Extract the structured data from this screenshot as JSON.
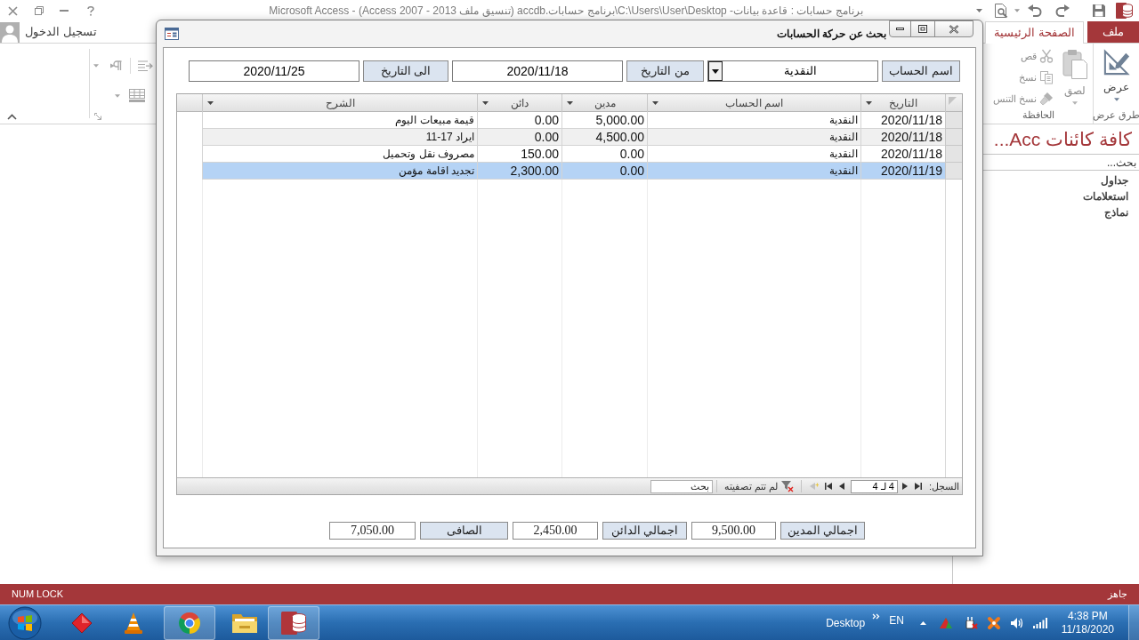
{
  "window": {
    "title": "برنامج حسابات : قاعدة بيانات- C:\\Users\\User\\Desktop\\برنامج حسابات.accdb (تنسيق ملف Access 2007 - 2013) - Microsoft Access"
  },
  "account": {
    "label": "تسجيل الدخول"
  },
  "ribbon": {
    "tabs": [
      {
        "label": "ملف",
        "kind": "file",
        "selected": false
      },
      {
        "label": "الصفحة الرئيسية",
        "kind": "tab",
        "selected": true
      }
    ],
    "groups": [
      {
        "label": "طرق عرض",
        "buttons": [
          {
            "label": "عرض",
            "kind": "view",
            "disabled": false
          }
        ]
      },
      {
        "label": "الحافظة",
        "buttons": [
          {
            "label": "لصق",
            "kind": "paste",
            "disabled": true
          },
          {
            "label": "قص",
            "kind": "cut",
            "disabled": true
          },
          {
            "label": "نسخ",
            "kind": "copy",
            "disabled": true
          },
          {
            "label": "نسخ التنس",
            "kind": "painter",
            "disabled": true
          }
        ]
      }
    ]
  },
  "nav_pane": {
    "title": "كافة كائنات Acc...",
    "search": {
      "placeholder": "بحث..."
    },
    "groups": [
      {
        "label": "جداول"
      },
      {
        "label": "استعلامات"
      },
      {
        "label": "نماذج"
      }
    ]
  },
  "dialog": {
    "title": "بحث عن حركة الحسابات",
    "filters": [
      {
        "label": "اسم الحساب",
        "kind": "combo",
        "value": "النقدية"
      },
      {
        "label": "من التاريخ",
        "kind": "text",
        "value": "2020/11/18"
      },
      {
        "label": "الى التاريخ",
        "kind": "text",
        "value": "2020/11/25"
      }
    ],
    "table": {
      "columns": [
        "التاريخ",
        "اسم الحساب",
        "مدين",
        "دائن",
        "الشرح"
      ],
      "rows": [
        {
          "cells": [
            "2020/11/18",
            "النقدية",
            "5,000.00",
            "0.00",
            "قيمة مبيعات اليوم"
          ],
          "selected": false
        },
        {
          "cells": [
            "2020/11/18",
            "النقدية",
            "4,500.00",
            "0.00",
            "ايراد 17-11"
          ],
          "selected": false
        },
        {
          "cells": [
            "2020/11/18",
            "النقدية",
            "0.00",
            "150.00",
            "مصروف نقل وتحميل"
          ],
          "selected": false
        },
        {
          "cells": [
            "2020/11/19",
            "النقدية",
            "0.00",
            "2,300.00",
            "تجديد اقامة مؤمن"
          ],
          "selected": true
        }
      ]
    },
    "record_nav": {
      "label": "السجل:",
      "position": "4 لـ 4",
      "filter_status": "لم تتم تصفيته",
      "search": {
        "placeholder": "بحث"
      }
    },
    "totals": [
      {
        "label": "اجمالي المدين",
        "value": "9,500.00"
      },
      {
        "label": "اجمالي الدائن",
        "value": "2,450.00"
      },
      {
        "label": "الصافى",
        "value": "7,050.00"
      }
    ]
  },
  "status_bar": {
    "status": "جاهز",
    "indicator": "NUM LOCK"
  },
  "taskbar": {
    "apps": [
      {
        "kind": "diamond",
        "running": false
      },
      {
        "kind": "cone",
        "running": false
      },
      {
        "kind": "browser",
        "running": true
      },
      {
        "kind": "folder",
        "running": false
      },
      {
        "kind": "database",
        "running": true
      }
    ],
    "toolbar_label": "Desktop",
    "language": "EN",
    "time": "4:38 PM",
    "date": "11/18/2020"
  }
}
